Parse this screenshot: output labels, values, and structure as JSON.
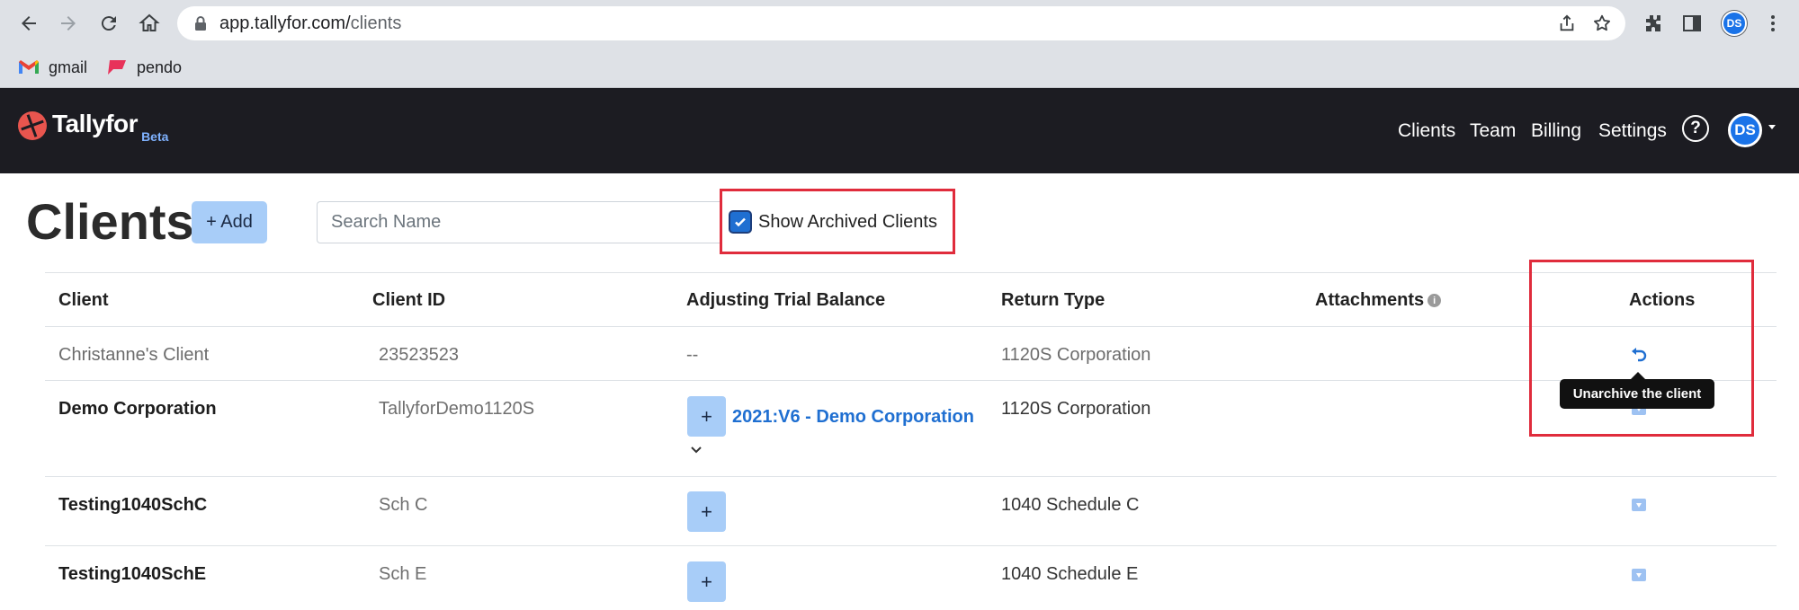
{
  "browser": {
    "url_host": "app.tallyfor.com/",
    "url_path": "clients",
    "profile_initials": "DS",
    "bookmarks": [
      {
        "label": "gmail",
        "icon": "gmail-icon"
      },
      {
        "label": "pendo",
        "icon": "pendo-icon"
      }
    ]
  },
  "app": {
    "logo_text": "Tallyfor",
    "logo_badge": "Beta",
    "nav": [
      "Clients",
      "Team",
      "Billing",
      "Settings"
    ],
    "help_glyph": "?",
    "user_initials": "DS",
    "brand_color": "#e8554e",
    "header_bg": "#1c1c22"
  },
  "page": {
    "title": "Clients",
    "add_label": "+ Add",
    "search_placeholder": "Search Name",
    "show_archived_label": "Show Archived Clients",
    "show_archived_checked": true
  },
  "table": {
    "columns": [
      "Client",
      "Client ID",
      "Adjusting Trial Balance",
      "Return Type",
      "Attachments",
      "Actions"
    ],
    "rows": [
      {
        "client": "Christanne's Client",
        "client_id": "23523523",
        "atb": "--",
        "atb_link": "",
        "return_type": "1120S Corporation",
        "archived": true,
        "action_icon": "undo-icon"
      },
      {
        "client": "Demo Corporation",
        "client_id": "TallyforDemo1120S",
        "atb": "+",
        "atb_link": "2021:V6 - Demo Corporation",
        "return_type": "1120S Corporation",
        "archived": false,
        "action_icon": "archive-icon"
      },
      {
        "client": "Testing1040SchC",
        "client_id": "Sch C",
        "atb": "+",
        "atb_link": "",
        "return_type": "1040 Schedule C",
        "archived": false,
        "action_icon": "archive-icon"
      },
      {
        "client": "Testing1040SchE",
        "client_id": "Sch E",
        "atb": "+",
        "atb_link": "",
        "return_type": "1040 Schedule E",
        "archived": false,
        "action_icon": "archive-icon"
      }
    ]
  },
  "tooltip": {
    "text": "Unarchive the client"
  },
  "colors": {
    "highlight_red": "#e02c3c",
    "link_blue": "#1f6fd1",
    "button_light_blue": "#a8cdf8"
  }
}
